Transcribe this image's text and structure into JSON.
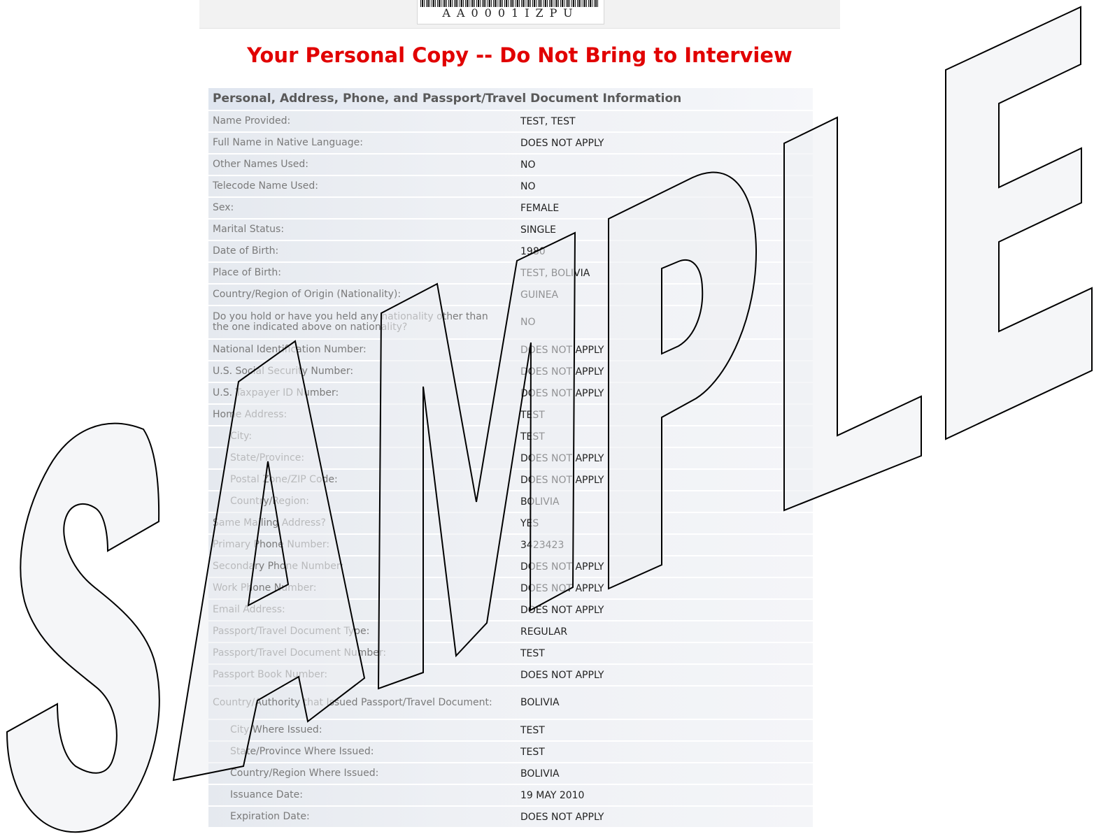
{
  "barcode": {
    "text": "AA0001IZPU"
  },
  "heading": "Your Personal Copy -- Do Not Bring to Interview",
  "section": {
    "title": "Personal, Address, Phone, and Passport/Travel Document Information",
    "rows": [
      {
        "label": "Name Provided:",
        "value": "TEST, TEST"
      },
      {
        "label": "Full Name in Native Language:",
        "value": "DOES NOT APPLY"
      },
      {
        "label": "Other Names Used:",
        "value": "NO"
      },
      {
        "label": "Telecode Name Used:",
        "value": "NO"
      },
      {
        "label": "Sex:",
        "value": "FEMALE"
      },
      {
        "label": "Marital Status:",
        "value": "SINGLE"
      },
      {
        "label": "Date of Birth:",
        "value": "1980"
      },
      {
        "label": "Place of Birth:",
        "value": "TEST, BOLIVIA"
      },
      {
        "label": "Country/Region of Origin (Nationality):",
        "value": "GUINEA"
      },
      {
        "label": "Do you hold or have you held any nationality other than the one indicated above on nationality?",
        "value": "NO"
      },
      {
        "label": "National Identification Number:",
        "value": "DOES NOT APPLY"
      },
      {
        "label": "U.S. Social Security Number:",
        "value": "DOES NOT APPLY"
      },
      {
        "label": "U.S. Taxpayer ID Number:",
        "value": "DOES NOT APPLY"
      },
      {
        "label": "Home Address:",
        "value": "TEST"
      },
      {
        "label": "City:",
        "value": "TEST"
      },
      {
        "label": "State/Province:",
        "value": "DOES NOT APPLY"
      },
      {
        "label": "Postal Zone/ZIP Code:",
        "value": "DOES NOT APPLY"
      },
      {
        "label": "Country/Region:",
        "value": "BOLIVIA"
      },
      {
        "label": "Same Mailing Address?",
        "value": "YES"
      },
      {
        "label": "Primary Phone Number:",
        "value": "3423423"
      },
      {
        "label": "Secondary Phone Number:",
        "value": "DOES NOT APPLY"
      },
      {
        "label": "Work Phone Number:",
        "value": "DOES NOT APPLY"
      },
      {
        "label": "Email Address:",
        "value": "DOES NOT APPLY"
      },
      {
        "label": "Passport/Travel Document Type:",
        "value": "REGULAR"
      },
      {
        "label": "Passport/Travel Document Number:",
        "value": "TEST"
      },
      {
        "label": "Passport Book Number:",
        "value": "DOES NOT APPLY"
      },
      {
        "label": "Country/Authority that Issued Passport/Travel Document:",
        "value": "BOLIVIA"
      },
      {
        "label": "City Where Issued:",
        "value": "TEST"
      },
      {
        "label": "State/Province Where Issued:",
        "value": "TEST"
      },
      {
        "label": "Country/Region Where Issued:",
        "value": "BOLIVIA"
      },
      {
        "label": "Issuance Date:",
        "value": "19 MAY 2010"
      },
      {
        "label": "Expiration Date:",
        "value": "DOES NOT APPLY"
      }
    ]
  },
  "watermark": "SAMPLE"
}
